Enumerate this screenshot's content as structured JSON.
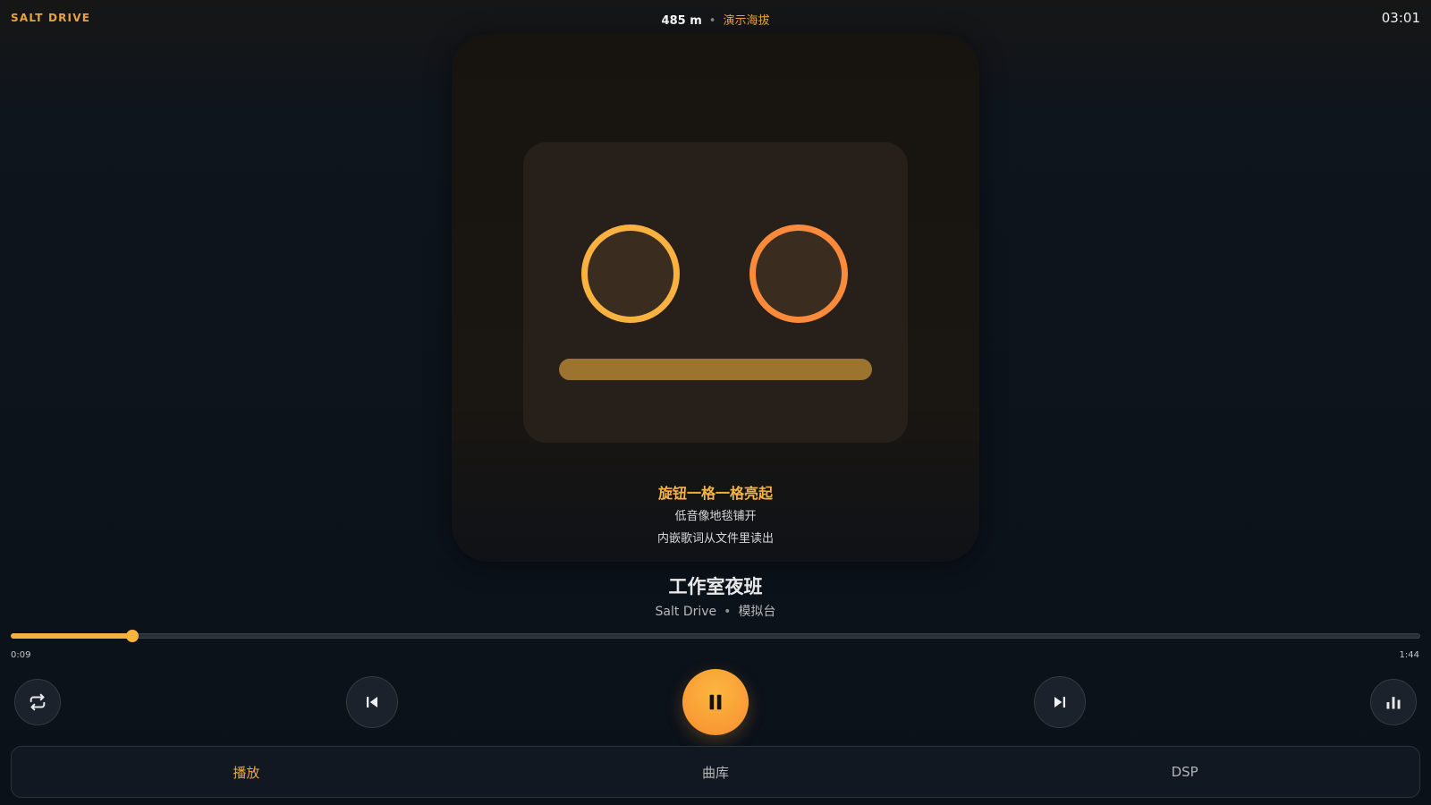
{
  "app": {
    "brand": "SALT DRIVE",
    "clock": "03:01"
  },
  "status": {
    "altitude": "485 m",
    "separator": "•",
    "altitude_label": "演示海拔"
  },
  "lyrics": {
    "current": "旋钮一格一格亮起",
    "next": [
      "低音像地毯铺开",
      "内嵌歌词从文件里读出"
    ]
  },
  "track": {
    "title": "工作室夜班",
    "artist": "Salt Drive",
    "separator": "•",
    "album": "模拟台"
  },
  "progress": {
    "elapsed": "0:09",
    "total": "1:44",
    "fraction": 0.0865
  },
  "controls": {
    "repeat_icon": "repeat-icon",
    "prev_icon": "skip-previous-icon",
    "play_state": "playing",
    "pause_icon": "pause-icon",
    "next_icon": "skip-next-icon",
    "eq_icon": "equalizer-icon"
  },
  "tabs": [
    {
      "label": "播放",
      "active": true
    },
    {
      "label": "曲库",
      "active": false
    },
    {
      "label": "DSP",
      "active": false
    }
  ],
  "colors": {
    "accent": "#f0a636",
    "accent_bright": "#f9b43d",
    "knob_left": "#f9b23f",
    "knob_right": "#fb8a3a",
    "background": "#0b1119"
  }
}
